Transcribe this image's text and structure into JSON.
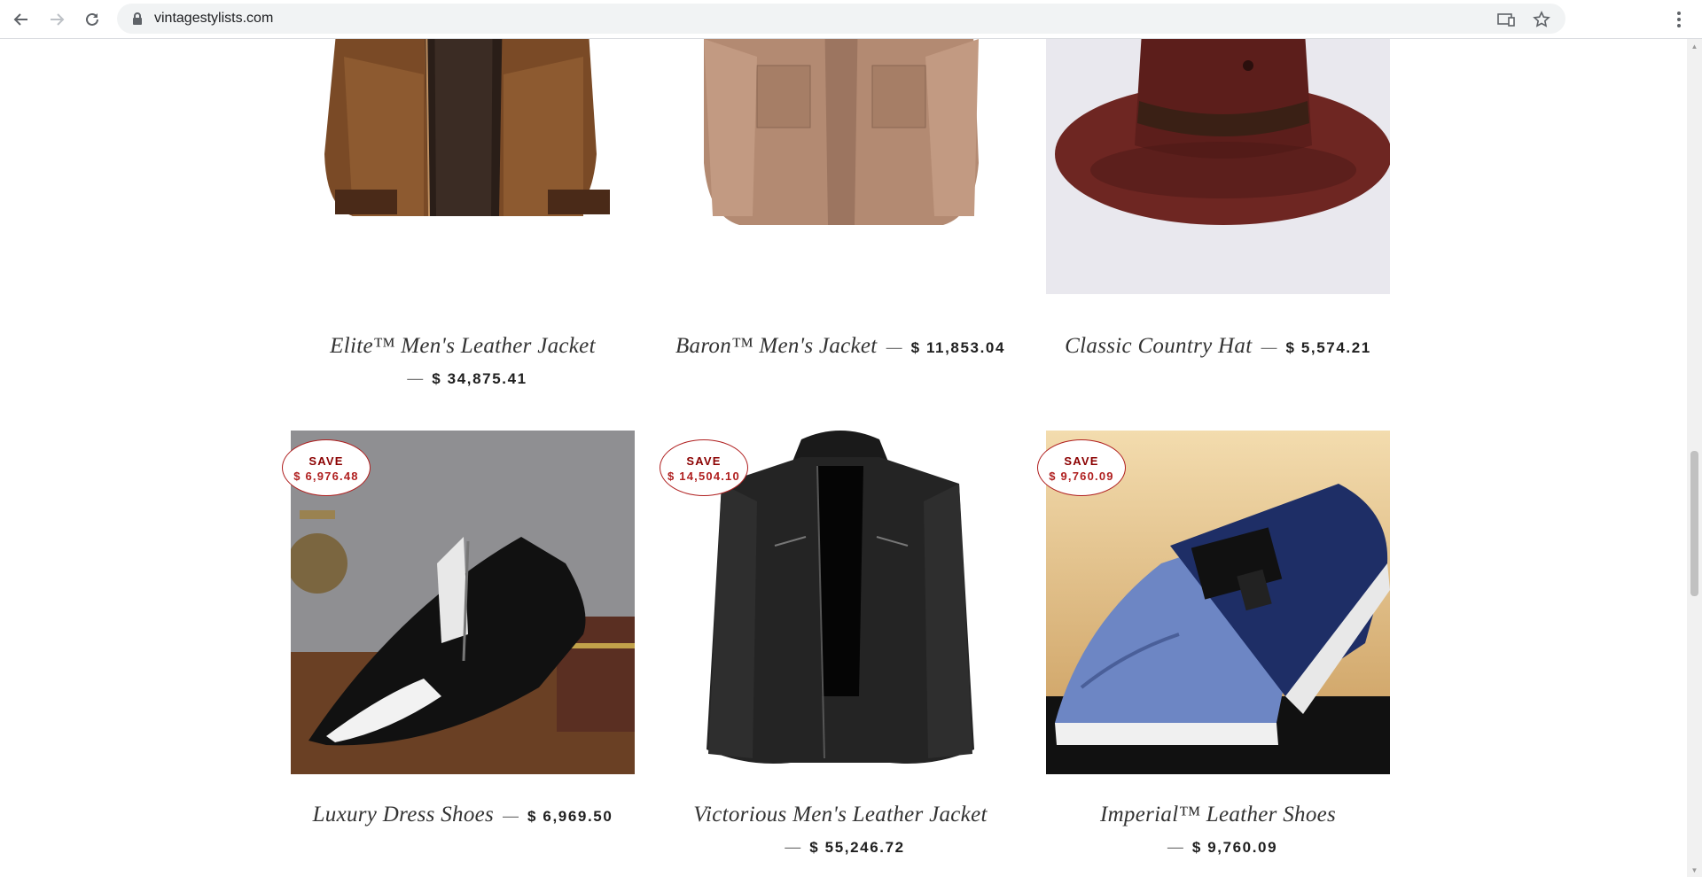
{
  "browser": {
    "url": "vintagestylists.com",
    "icons": [
      "back-arrow-icon",
      "forward-arrow-icon",
      "reload-icon",
      "lock-icon",
      "cast-icon",
      "star-icon",
      "menu-dots-icon"
    ]
  },
  "colors": {
    "badge_border": "#b02020",
    "badge_text": "#8b0000",
    "price": "#1f1f1f",
    "title": "#333333"
  },
  "products": [
    {
      "title": "Elite™ Men's Leather Jacket",
      "dash": "—",
      "price": "$ 34,875.41",
      "image": "brown-leather-jacket"
    },
    {
      "title": "Baron™ Men's Jacket",
      "dash": "—",
      "price": "$ 11,853.04",
      "image": "tan-leather-jacket"
    },
    {
      "title": "Classic Country Hat",
      "dash": "—",
      "price": "$ 5,574.21",
      "image": "brown-leather-hat"
    },
    {
      "title": "Luxury Dress Shoes",
      "dash": "—",
      "price": "$ 6,969.50",
      "image": "black-dress-shoe",
      "badge": {
        "label": "SAVE",
        "amount": "$ 6,976.48"
      }
    },
    {
      "title": "Victorious Men's Leather Jacket",
      "dash": "—",
      "price": "$ 55,246.72",
      "image": "black-leather-jacket",
      "badge": {
        "label": "SAVE",
        "amount": "$ 14,504.10"
      }
    },
    {
      "title": "Imperial™ Leather Shoes",
      "dash": "—",
      "price": "$ 9,760.09",
      "image": "blue-slip-on-shoes",
      "badge": {
        "label": "SAVE",
        "amount": "$ 9,760.09"
      }
    }
  ]
}
